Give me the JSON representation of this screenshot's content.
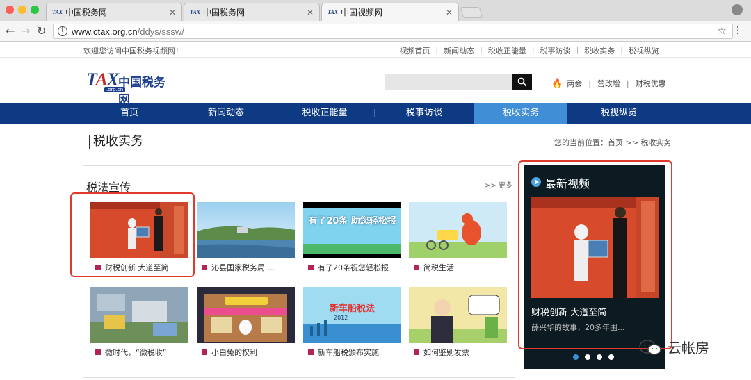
{
  "browser": {
    "tabs": [
      {
        "label": "中国税务网",
        "favicon": "TAX"
      },
      {
        "label": "中国税务网",
        "favicon": "TAX"
      },
      {
        "label": "中国视频网",
        "favicon": "TAX"
      }
    ],
    "url_host": "www.ctax.org.cn",
    "url_path": "/ddys/sssw/"
  },
  "topbar": {
    "welcome": "欢迎您访问中国税务视频网！",
    "links": [
      "视频首页",
      "新闻动态",
      "税收正能量",
      "税事访谈",
      "税收实务",
      "税视纵览"
    ]
  },
  "header": {
    "logo_tax": "TAX",
    "logo_cn": "中国税务网",
    "logo_domain": ".org.cn",
    "hot_links": [
      "两会",
      "营改增",
      "财税优惠"
    ]
  },
  "nav": {
    "items": [
      "首页",
      "新闻动态",
      "税收正能量",
      "税事访谈",
      "税收实务",
      "税视纵览"
    ],
    "active_index": 4
  },
  "page": {
    "title": "税收实务",
    "breadcrumb": "您的当前位置：首页 >> 税收实务"
  },
  "section": {
    "title": "税法宣传",
    "more": ">> 更多",
    "videos": [
      {
        "caption": "财税创新 大道至简"
      },
      {
        "caption": "沁县国家税务局 ..."
      },
      {
        "caption": "有了20条祝您轻松报",
        "overlay": "有了20条 助您轻松报"
      },
      {
        "caption": "简税生活"
      },
      {
        "caption": "微时代，“微税收”"
      },
      {
        "caption": "小白兔的权利"
      },
      {
        "caption": "新车船税颁布实施",
        "overlay": "新车船税法",
        "year": "2012"
      },
      {
        "caption": "如何鉴别发票"
      }
    ]
  },
  "sidebar": {
    "title": "最新视频",
    "video_title": "财税创新 大道至简",
    "video_desc": "薛兴华的故事，20多年围...",
    "active_dot": 0,
    "dot_count": 4
  },
  "watermark": {
    "text": "云帐房"
  },
  "colors": {
    "nav_bg": "#0d3a82",
    "nav_active": "#3f8ed6",
    "highlight_box": "#e03a2b",
    "bullet": "#b3245a"
  }
}
